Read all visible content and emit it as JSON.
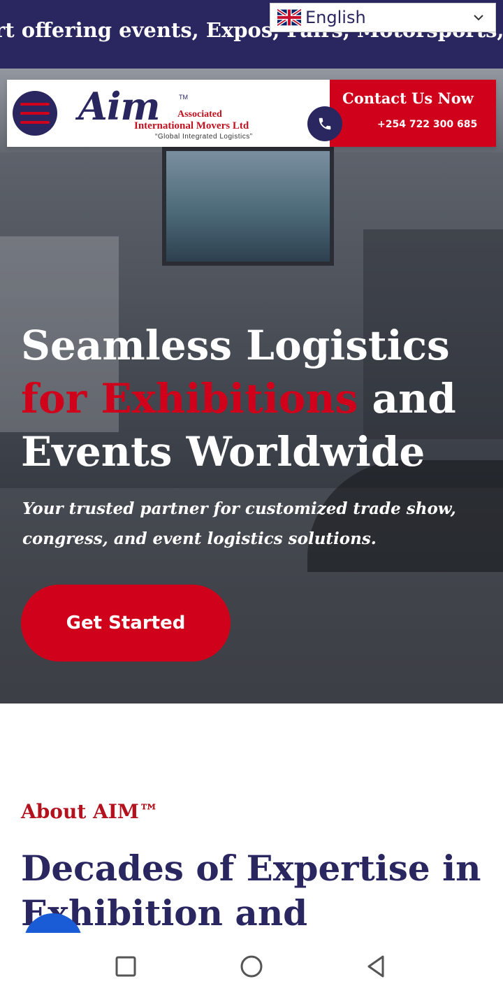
{
  "marquee": {
    "text": "rt offering events, Expos, Fairs, Motorsports, Spo"
  },
  "language": {
    "flag_icon": "uk-flag-icon",
    "label": "English",
    "chevron_icon": "chevron-down-icon"
  },
  "header": {
    "menu_icon": "hamburger-menu-icon",
    "logo": {
      "main": "Aim",
      "tm": "TM",
      "line1": "Associated",
      "line2": "International Movers Ltd",
      "tagline": "“Global Integrated Logistics”"
    },
    "contact": {
      "phone_icon": "phone-icon",
      "title": "Contact Us Now",
      "phone": "+254 722 300 685"
    }
  },
  "hero": {
    "title_part1": "Seamless Logistics ",
    "title_highlight": "for Exhibitions",
    "title_part2": " and Events Worldwide",
    "subtitle": "Your trusted partner for customized trade show, congress, and event logistics solutions.",
    "cta_label": "Get Started"
  },
  "about": {
    "label": "About AIM™",
    "heading": "Decades of Expertise in Exhibition and"
  },
  "colors": {
    "navy": "#2a2660",
    "red": "#d0021b",
    "white": "#ffffff"
  },
  "system_nav": {
    "recents_icon": "square-recents-icon",
    "home_icon": "circle-home-icon",
    "back_icon": "triangle-back-icon"
  }
}
